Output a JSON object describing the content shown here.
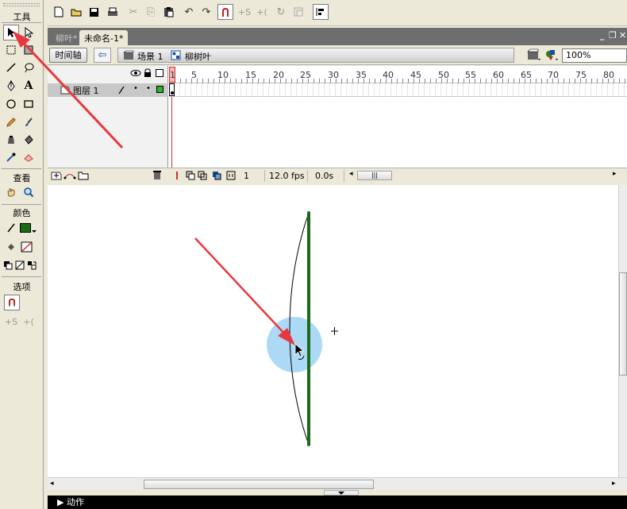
{
  "tools_panel": {
    "tools_title": "工具",
    "view_title": "查看",
    "color_title": "颜色",
    "options_title": "选项"
  },
  "doc_tabs": {
    "tab1": "柳叶*",
    "tab2": "未命名-1*"
  },
  "edit_bar": {
    "timeline_button": "时间轴",
    "scene": "场景 1",
    "symbol": "柳树叶",
    "zoom": "100%"
  },
  "timeline": {
    "layer_name": "图层 1",
    "ruler_numbers": [
      "1",
      "5",
      "10",
      "15",
      "20",
      "25",
      "30",
      "35",
      "40",
      "45",
      "50",
      "55",
      "60",
      "65",
      "70",
      "75",
      "80"
    ],
    "current_frame": "1",
    "fps": "12.0 fps",
    "time": "0.0s"
  },
  "panels": {
    "actions_label": "▶ 动作"
  },
  "colors": {
    "stroke_color": "#1b6b1b",
    "highlight_circle": "#9dd3f5",
    "annotation_arrow": "#e8383d"
  }
}
